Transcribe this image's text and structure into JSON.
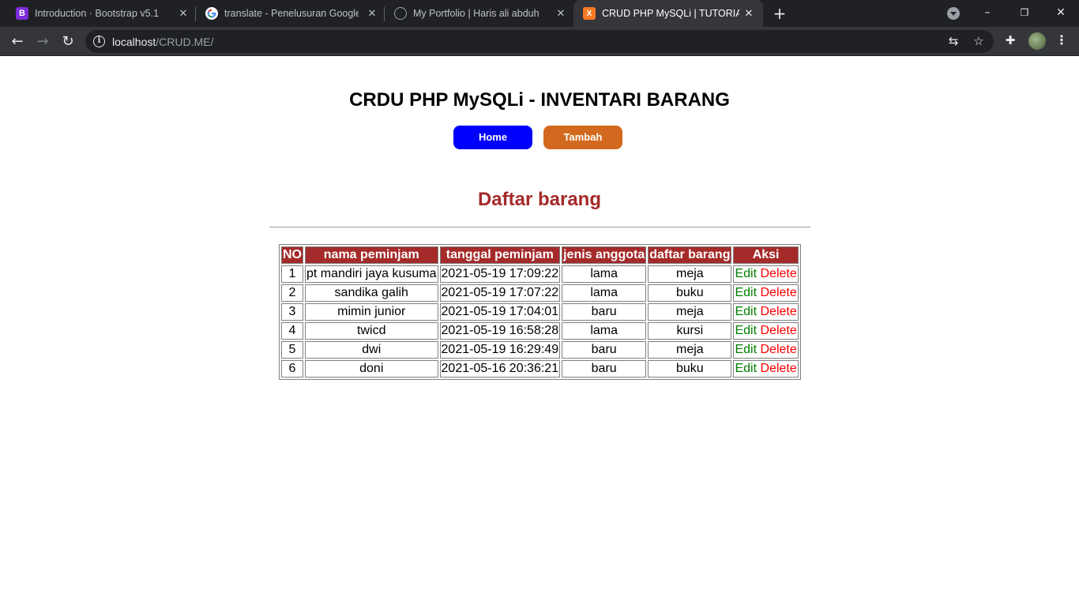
{
  "browser": {
    "tabs": [
      {
        "title": "Introduction · Bootstrap v5.1",
        "favicon": "bootstrap-icon",
        "favicon_text": "B",
        "active": false
      },
      {
        "title": "translate - Penelusuran Google",
        "favicon": "google-icon",
        "favicon_text": "G",
        "active": false
      },
      {
        "title": "My Portfolio | Haris ali abduh",
        "favicon": "globe-icon",
        "favicon_text": "",
        "active": false
      },
      {
        "title": "CRUD PHP MySQLi | TUTORIALW",
        "favicon": "xampp-icon",
        "favicon_text": "X",
        "active": true
      }
    ],
    "new_tab": "+",
    "address": {
      "host": "localhost",
      "path": "/CRUD.ME/"
    },
    "colors": {
      "tabbar": "#202124",
      "toolbar": "#35363a",
      "omnibox": "#202124"
    }
  },
  "page": {
    "title": "CRDU PHP MySQLi - INVENTARI BARANG",
    "buttons": {
      "home": "Home",
      "tambah": "Tambah"
    },
    "section_title": "Daftar barang",
    "table": {
      "headers": [
        "NO",
        "nama peminjam",
        "tanggal peminjam",
        "jenis anggota",
        "daftar barang",
        "Aksi"
      ],
      "rows": [
        {
          "no": "1",
          "nama": "pt mandiri jaya kusuma",
          "tanggal": "2021-05-19 17:09:22",
          "jenis": "lama",
          "barang": "meja"
        },
        {
          "no": "2",
          "nama": "sandika galih",
          "tanggal": "2021-05-19 17:07:22",
          "jenis": "lama",
          "barang": "buku"
        },
        {
          "no": "3",
          "nama": "mimin junior",
          "tanggal": "2021-05-19 17:04:01",
          "jenis": "baru",
          "barang": "meja"
        },
        {
          "no": "4",
          "nama": "twicd",
          "tanggal": "2021-05-19 16:58:28",
          "jenis": "lama",
          "barang": "kursi"
        },
        {
          "no": "5",
          "nama": "dwi",
          "tanggal": "2021-05-19 16:29:49",
          "jenis": "baru",
          "barang": "meja"
        },
        {
          "no": "6",
          "nama": "doni",
          "tanggal": "2021-05-16 20:36:21",
          "jenis": "baru",
          "barang": "buku"
        }
      ],
      "actions": {
        "edit": "Edit",
        "delete": "Delete"
      }
    },
    "colors": {
      "home_button": "#0000ff",
      "tambah_button": "#d2691e",
      "header_bg": "#a52a2a",
      "section_title": "#a52a2a",
      "edit_link": "#008000",
      "delete_link": "#ff0000"
    }
  }
}
